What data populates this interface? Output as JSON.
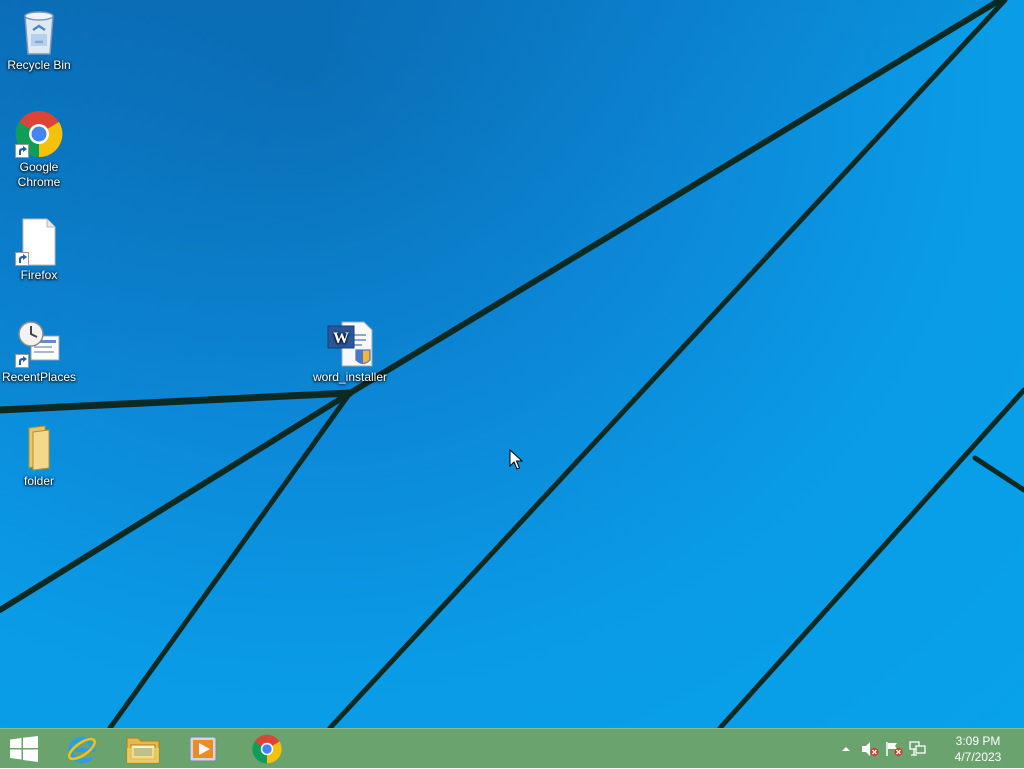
{
  "desktop": {
    "icons": [
      {
        "label": "Recycle Bin",
        "icon": "recycle-bin-icon"
      },
      {
        "label": "Google Chrome",
        "icon": "chrome-icon"
      },
      {
        "label": "Firefox",
        "icon": "file-icon"
      },
      {
        "label": "RecentPlaces",
        "icon": "recent-places-icon"
      },
      {
        "label": "folder",
        "icon": "folder-icon"
      },
      {
        "label": "word_installer",
        "icon": "word-installer-icon"
      }
    ]
  },
  "taskbar": {
    "pinned": [
      {
        "name": "Start",
        "icon": "windows-logo-icon"
      },
      {
        "name": "Internet Explorer",
        "icon": "internet-explorer-icon"
      },
      {
        "name": "File Explorer",
        "icon": "file-explorer-icon"
      },
      {
        "name": "Windows Media Player",
        "icon": "media-player-icon"
      },
      {
        "name": "Google Chrome",
        "icon": "chrome-icon"
      }
    ],
    "tray": {
      "icons": [
        "show-hidden-icons-icon",
        "volume-muted-icon",
        "action-center-flag-icon",
        "network-icon"
      ]
    },
    "clock": {
      "time": "3:09 PM",
      "date": "4/7/2023"
    }
  },
  "colors": {
    "wallpaper_blue": "#0a9be6",
    "taskbar": "#6aa36e",
    "text": "#ffffff"
  }
}
